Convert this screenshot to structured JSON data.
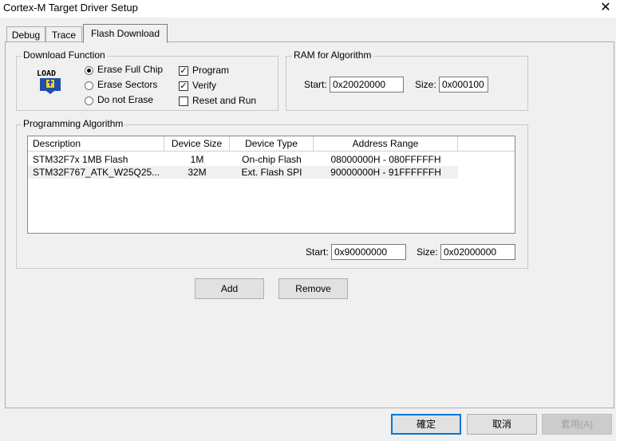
{
  "window": {
    "title": "Cortex-M Target Driver Setup"
  },
  "tabs": [
    {
      "label": "Debug"
    },
    {
      "label": "Trace"
    },
    {
      "label": "Flash Download"
    }
  ],
  "download_function": {
    "label": "Download Function",
    "icon_text": "LOAD",
    "options": [
      {
        "label": "Erase Full Chip",
        "selected": true
      },
      {
        "label": "Erase Sectors",
        "selected": false
      },
      {
        "label": "Do not Erase",
        "selected": false
      }
    ],
    "checks": [
      {
        "label": "Program",
        "checked": true
      },
      {
        "label": "Verify",
        "checked": true
      },
      {
        "label": "Reset and Run",
        "checked": false
      }
    ]
  },
  "ram": {
    "label": "RAM for Algorithm",
    "start_label": "Start:",
    "start_value": "0x20020000",
    "size_label": "Size:",
    "size_value": "0x000100"
  },
  "programming": {
    "label": "Programming Algorithm",
    "columns": [
      "Description",
      "Device Size",
      "Device Type",
      "Address Range"
    ],
    "rows": [
      [
        "STM32F7x 1MB Flash",
        "1M",
        "On-chip Flash",
        "08000000H - 080FFFFFH"
      ],
      [
        "STM32F767_ATK_W25Q25...",
        "32M",
        "Ext. Flash SPI",
        "90000000H - 91FFFFFFH"
      ]
    ],
    "start_label": "Start:",
    "start_value": "0x90000000",
    "size_label": "Size:",
    "size_value": "0x02000000"
  },
  "buttons": {
    "add": "Add",
    "remove": "Remove",
    "ok": "確定",
    "cancel": "取消",
    "apply": "套用(A)"
  }
}
